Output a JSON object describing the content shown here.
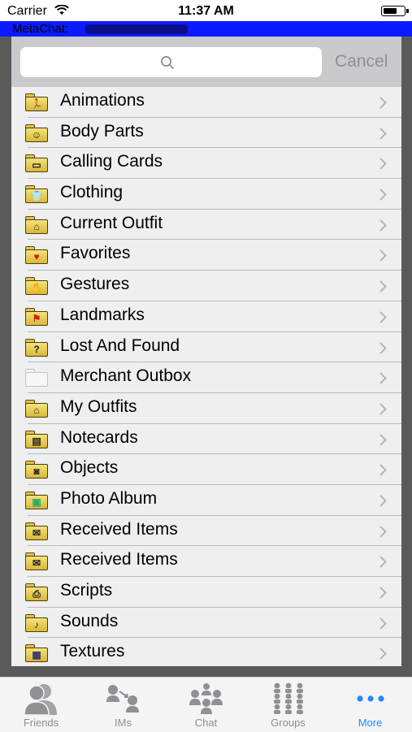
{
  "status_bar": {
    "carrier": "Carrier",
    "time": "11:37 AM",
    "wifi_icon": "wifi-icon",
    "battery_icon": "battery-icon"
  },
  "title_bar": {
    "text": "MetaChat:",
    "background_color": "#0a1cff"
  },
  "search": {
    "value": "",
    "placeholder": "",
    "cancel_label": "Cancel",
    "icon": "search-icon"
  },
  "inventory": {
    "items": [
      {
        "label": "Animations",
        "icon": "animation-folder-icon"
      },
      {
        "label": "Body Parts",
        "icon": "body-parts-folder-icon"
      },
      {
        "label": "Calling Cards",
        "icon": "calling-card-folder-icon"
      },
      {
        "label": "Clothing",
        "icon": "clothing-folder-icon"
      },
      {
        "label": "Current Outfit",
        "icon": "outfit-folder-icon"
      },
      {
        "label": "Favorites",
        "icon": "favorites-folder-icon"
      },
      {
        "label": "Gestures",
        "icon": "gestures-folder-icon"
      },
      {
        "label": "Landmarks",
        "icon": "landmark-folder-icon"
      },
      {
        "label": "Lost And Found",
        "icon": "lost-and-found-folder-icon"
      },
      {
        "label": "Merchant Outbox",
        "icon": "merchant-outbox-folder-icon"
      },
      {
        "label": "My Outfits",
        "icon": "outfit-folder-icon"
      },
      {
        "label": "Notecards",
        "icon": "notecard-folder-icon"
      },
      {
        "label": "Objects",
        "icon": "objects-folder-icon"
      },
      {
        "label": "Photo Album",
        "icon": "photo-album-folder-icon"
      },
      {
        "label": "Received Items",
        "icon": "inbox-folder-icon"
      },
      {
        "label": "Received Items",
        "icon": "inbox-folder-icon"
      },
      {
        "label": "Scripts",
        "icon": "scripts-folder-icon"
      },
      {
        "label": "Sounds",
        "icon": "sounds-folder-icon"
      },
      {
        "label": "Textures",
        "icon": "textures-folder-icon"
      }
    ]
  },
  "tab_bar": {
    "tabs": [
      {
        "label": "Friends",
        "icon": "friends-icon",
        "active": false
      },
      {
        "label": "IMs",
        "icon": "ims-icon",
        "active": false
      },
      {
        "label": "Chat",
        "icon": "chat-icon",
        "active": false
      },
      {
        "label": "Groups",
        "icon": "groups-icon",
        "active": false
      },
      {
        "label": "More",
        "icon": "more-icon",
        "active": true
      }
    ],
    "active_color": "#1a8cff",
    "inactive_color": "#8e8e93"
  }
}
